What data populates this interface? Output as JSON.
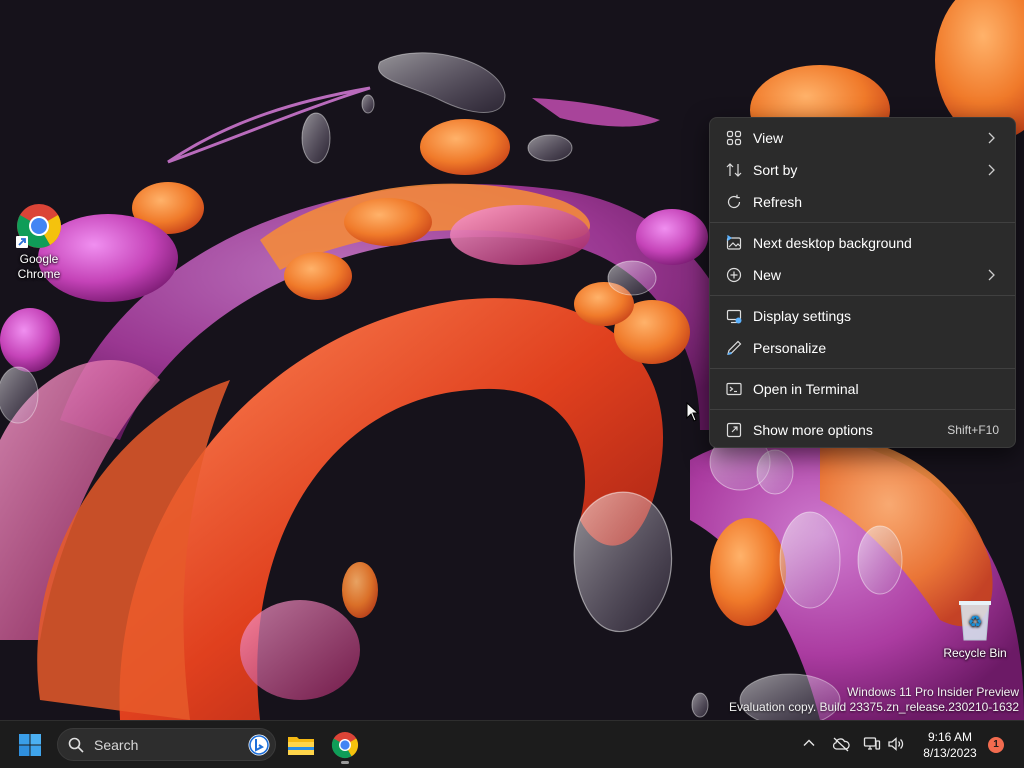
{
  "desktop": {
    "icons": [
      {
        "label_line1": "Google",
        "label_line2": "Chrome"
      },
      {
        "label_line1": "Recycle Bin"
      }
    ],
    "watermark": {
      "line1": "Windows 11 Pro Insider Preview",
      "line2": "Evaluation copy. Build 23375.zn_release.230210-1632"
    }
  },
  "context_menu": {
    "items": [
      {
        "label": "View",
        "icon": "grid-icon",
        "submenu": true
      },
      {
        "label": "Sort by",
        "icon": "sort-icon",
        "submenu": true
      },
      {
        "label": "Refresh",
        "icon": "refresh-icon",
        "submenu": false
      },
      {
        "label": "Next desktop background",
        "icon": "next-background-icon",
        "submenu": false
      },
      {
        "label": "New",
        "icon": "new-plus-icon",
        "submenu": true
      },
      {
        "label": "Display settings",
        "icon": "display-icon",
        "submenu": false
      },
      {
        "label": "Personalize",
        "icon": "pen-icon",
        "submenu": false
      },
      {
        "label": "Open in Terminal",
        "icon": "terminal-icon",
        "submenu": false
      },
      {
        "label": "Show more options",
        "icon": "share-icon",
        "submenu": false,
        "shortcut": "Shift+F10"
      }
    ]
  },
  "taskbar": {
    "search_label": "Search",
    "clock_time": "9:16 AM",
    "clock_date": "8/13/2023",
    "notification_count": "1"
  },
  "colors": {
    "menu_bg": "#2b2b2b",
    "taskbar_bg": "#1c1c1c",
    "start_blue": "#3a9ee8",
    "badge": "#f26b4f"
  }
}
